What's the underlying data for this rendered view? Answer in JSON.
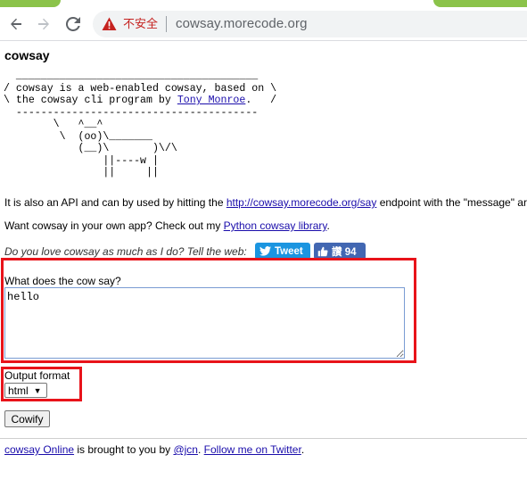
{
  "browser": {
    "insecure_label": "不安全",
    "url": "cowsay.morecode.org",
    "back_icon": "back-arrow-icon",
    "forward_icon": "forward-arrow-icon",
    "reload_icon": "reload-icon",
    "warning_icon": "warning-icon"
  },
  "page": {
    "title": "cowsay",
    "cow_lines": [
      "  _______________________________________",
      "/ cowsay is a web-enabled cowsay, based on \\",
      "\\ the cowsay cli program by ",
      "  ---------------------------------------",
      "        \\   ^__^",
      "         \\  (oo)\\_______",
      "            (__)\\       )\\/\\",
      "                ||----w |",
      "                ||     ||"
    ],
    "cow_link": "Tony Monroe",
    "cow_tail": ".   /",
    "api_text_pre": "It is also an API and can by used by hitting the ",
    "api_link": "http://cowsay.morecode.org/say",
    "api_text_post": " endpoint with the \"message\" ar",
    "want_pre": "Want cowsay in your own app? Check out my ",
    "want_link": "Python cowsay library",
    "want_post": ".",
    "love_text": "Do you love cowsay as much as I do? Tell the web:",
    "tweet_label": "Tweet",
    "like_label": "讚 94",
    "cow_say_label": "What does the cow say?",
    "cow_say_value": "hello",
    "output_format_label": "Output format",
    "output_format_value": "html",
    "cowify_label": "Cowify",
    "footer_link1": "cowsay Online",
    "footer_text1": " is brought to you by ",
    "footer_link2": "@jcn",
    "footer_text2": ". ",
    "footer_link3": "Follow me on Twitter",
    "footer_text3": "."
  },
  "colors": {
    "highlight": "#e8131a",
    "link": "#1a0dab",
    "tweet": "#1b95e0",
    "like": "#4267b2"
  }
}
